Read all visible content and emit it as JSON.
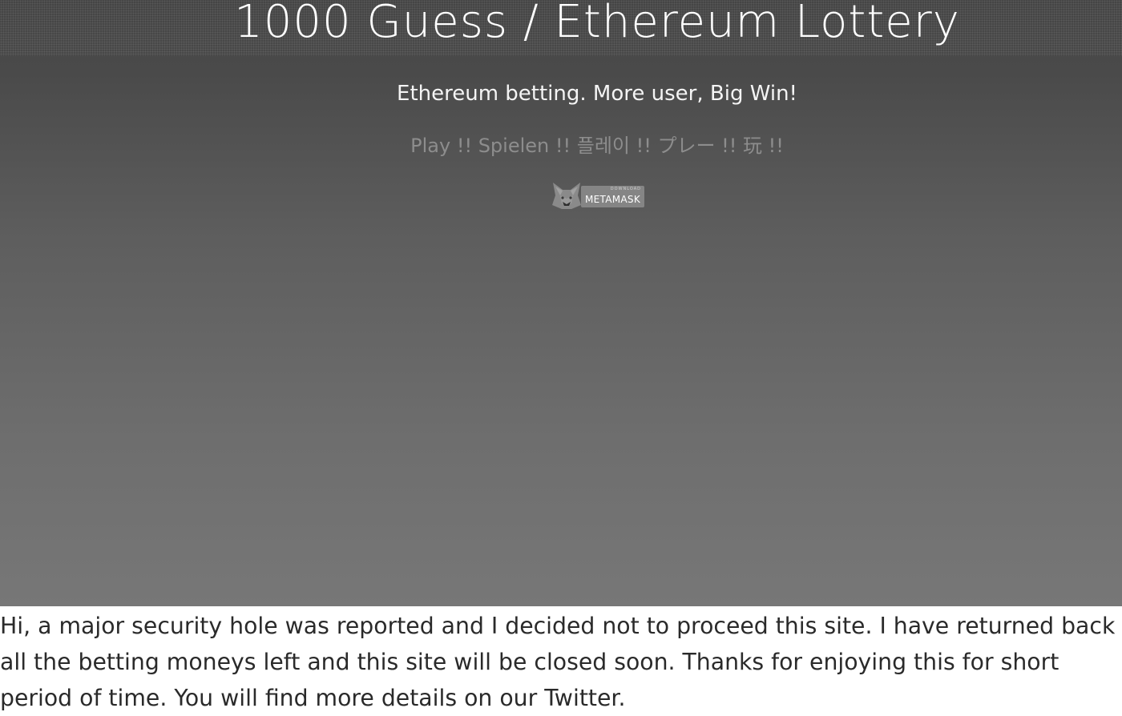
{
  "header": {
    "title": "1000 Guess / Ethereum Lottery",
    "subtitle": "Ethereum betting. More user, Big Win!",
    "play_link": "Play !! Spielen !! 플레이 !! プレー !! 玩 !!"
  },
  "metamask_button": {
    "small_label": "DOWNLOAD",
    "label": "METAMASK",
    "icon": "metamask-fox-icon"
  },
  "notice": {
    "text": "Hi, a major security hole was reported and I decided not to proceed this site. I have returned back all the betting moneys left and this site will be closed soon. Thanks for enjoying this for short period of time. You will find more details on our Twitter."
  },
  "colors": {
    "hero_top": "#454545",
    "hero_bottom": "#777777",
    "title_text": "#ffffff",
    "play_text": "#8d8d8d",
    "notice_text": "#2a2a2a"
  }
}
